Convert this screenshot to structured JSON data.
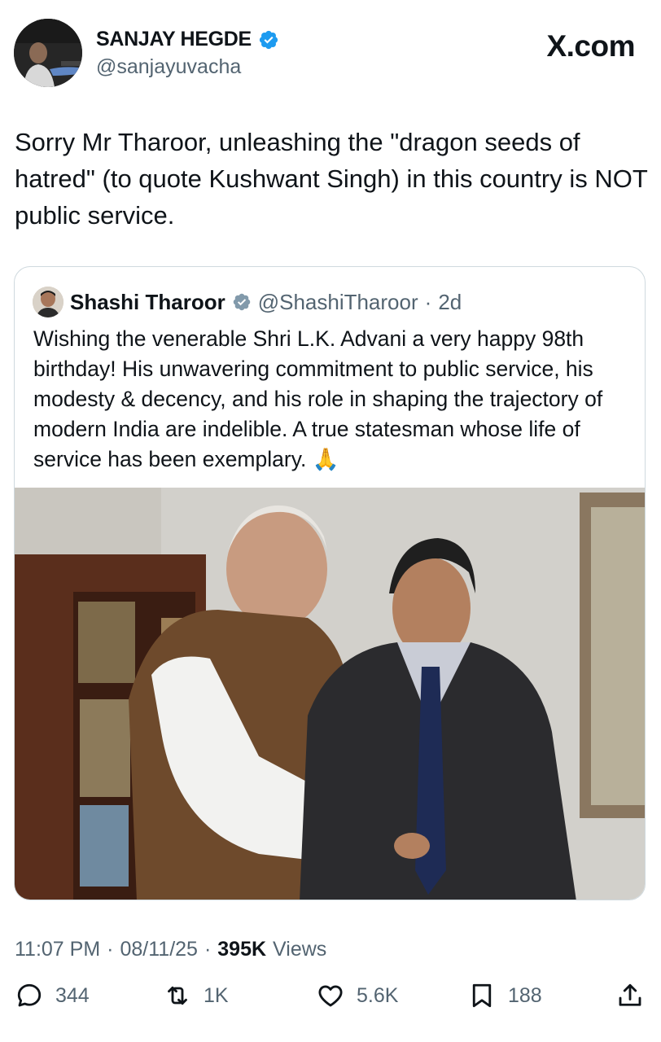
{
  "author": {
    "display_name": "SANJAY HEGDE",
    "handle": "@sanjayuvacha"
  },
  "brand": "X.com",
  "tweet_text": "Sorry Mr Tharoor, unleashing the \"dragon seeds of hatred\" (to quote Kushwant Singh)  in this country is NOT public service.",
  "quoted": {
    "display_name": "Shashi Tharoor",
    "handle": "@ShashiTharoor",
    "age": "2d",
    "text": "Wishing the venerable Shri L.K. Advani a very happy 98th birthday! His unwavering commitment to public service, his modesty & decency, and his role in shaping the trajectory of modern India are indelible. A true statesman whose life of service has been exemplary. 🙏"
  },
  "meta": {
    "time": "11:07 PM",
    "date": "08/11/25",
    "views_count": "395K",
    "views_label": "Views"
  },
  "actions": {
    "replies": "344",
    "reposts": "1K",
    "likes": "5.6K",
    "bookmarks": "188"
  },
  "colors": {
    "verified": "#1d9bf0",
    "secondary_text": "#536471",
    "border": "#cfd9de"
  },
  "icons": [
    "verified-badge-icon",
    "reply-icon",
    "repost-icon",
    "like-icon",
    "bookmark-icon",
    "share-icon"
  ]
}
